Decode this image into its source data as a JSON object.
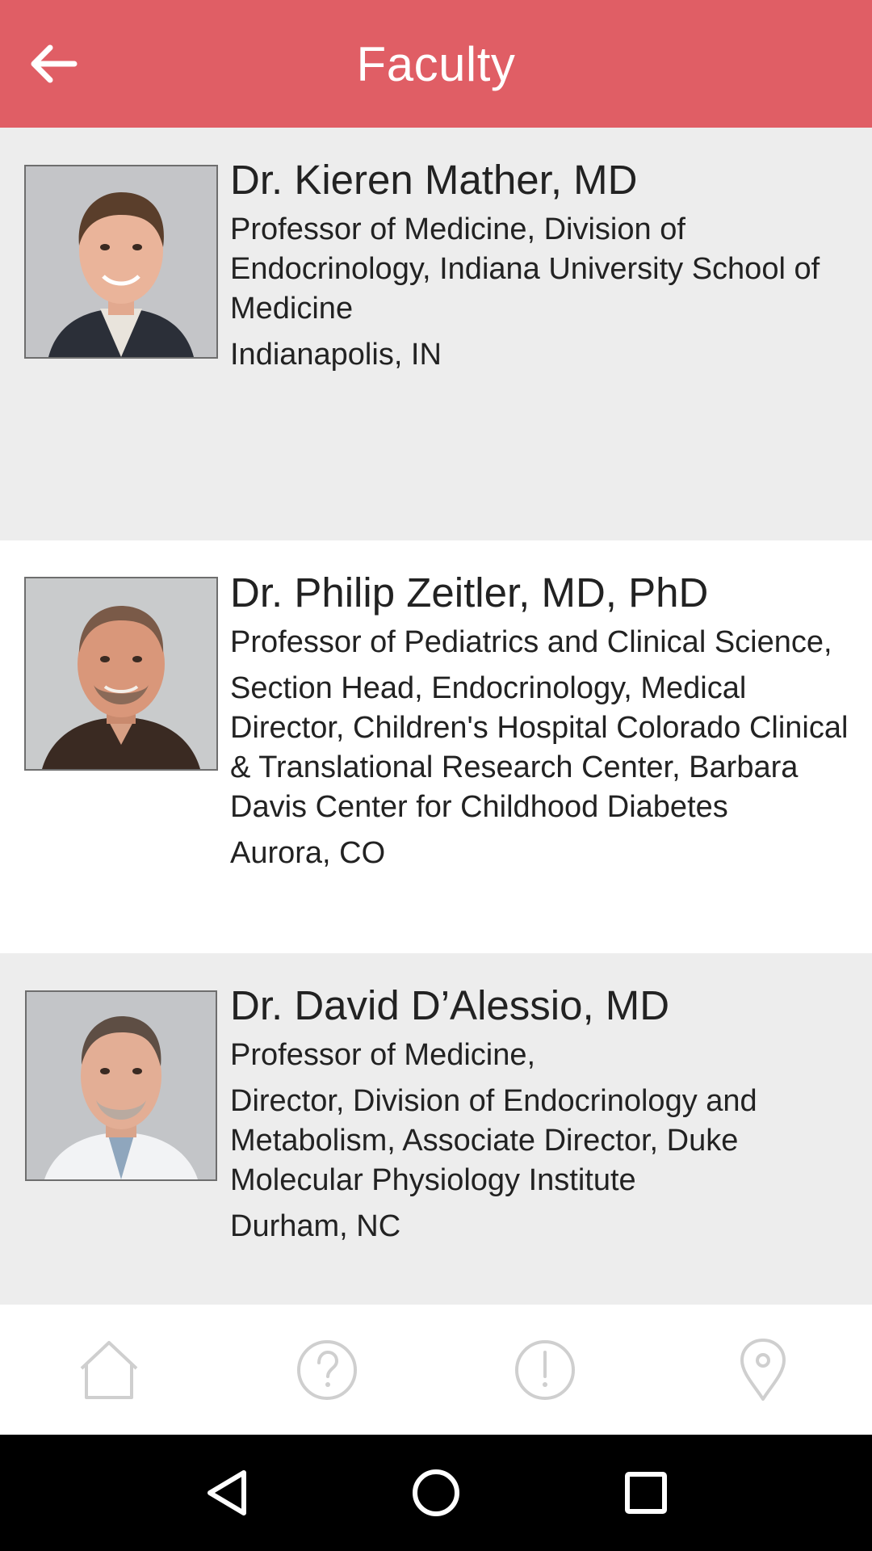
{
  "app_bar": {
    "title": "Faculty",
    "back_icon": "arrow-left-icon",
    "background": "#e05e65"
  },
  "faculty": [
    {
      "name": "Dr. Kieren Mather, MD",
      "lines": [
        "Professor of Medicine, Division of Endocrinology, Indiana University School of Medicine",
        "Indianapolis, IN"
      ]
    },
    {
      "name": "Dr. Philip Zeitler, MD, PhD",
      "lines": [
        "Professor of Pediatrics and Clinical Science,",
        "Section Head, Endocrinology, Medical Director, Children's Hospital Colorado Clinical & Translational Research Center, Barbara Davis Center for Childhood Diabetes",
        "Aurora, CO"
      ]
    },
    {
      "name": "Dr. David D’Alessio, MD",
      "lines": [
        "Professor of Medicine,",
        "Director, Division of Endocrinology and Metabolism, Associate Director, Duke Molecular Physiology Institute",
        "Durham, NC"
      ]
    }
  ],
  "bottom_nav": [
    {
      "icon": "home-icon"
    },
    {
      "icon": "help-icon"
    },
    {
      "icon": "alert-icon"
    },
    {
      "icon": "location-pin-icon"
    }
  ],
  "system_nav": [
    {
      "icon": "back-triangle-icon"
    },
    {
      "icon": "home-circle-icon"
    },
    {
      "icon": "recents-square-icon"
    }
  ]
}
